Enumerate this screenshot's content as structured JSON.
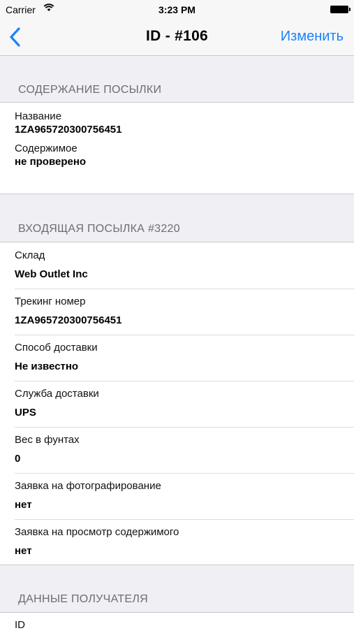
{
  "status_bar": {
    "carrier": "Carrier",
    "time": "3:23 PM"
  },
  "nav": {
    "title": "ID - #106",
    "edit_label": "Изменить"
  },
  "sections": {
    "contents": {
      "header": "СОДЕРЖАНИЕ ПОСЫЛКИ",
      "fields": [
        {
          "label": "Название",
          "value": "1ZA965720300756451"
        },
        {
          "label": "Содержимое",
          "value": "не проверено"
        }
      ]
    },
    "incoming": {
      "header": "ВХОДЯЩАЯ ПОСЫЛКА #3220",
      "fields": [
        {
          "label": "Склад",
          "value": "Web Outlet Inc"
        },
        {
          "label": "Трекинг номер",
          "value": "1ZA965720300756451"
        },
        {
          "label": "Способ доставки",
          "value": "Не известно"
        },
        {
          "label": "Служба доставки",
          "value": "UPS"
        },
        {
          "label": "Вес в фунтах",
          "value": "0"
        },
        {
          "label": "Заявка на фотографирование",
          "value": "нет"
        },
        {
          "label": "Заявка на просмотр содержимого",
          "value": "нет"
        }
      ]
    },
    "recipient": {
      "header": "ДАННЫЕ ПОЛУЧАТЕЛЯ",
      "fields": [
        {
          "label": "ID"
        }
      ]
    }
  }
}
